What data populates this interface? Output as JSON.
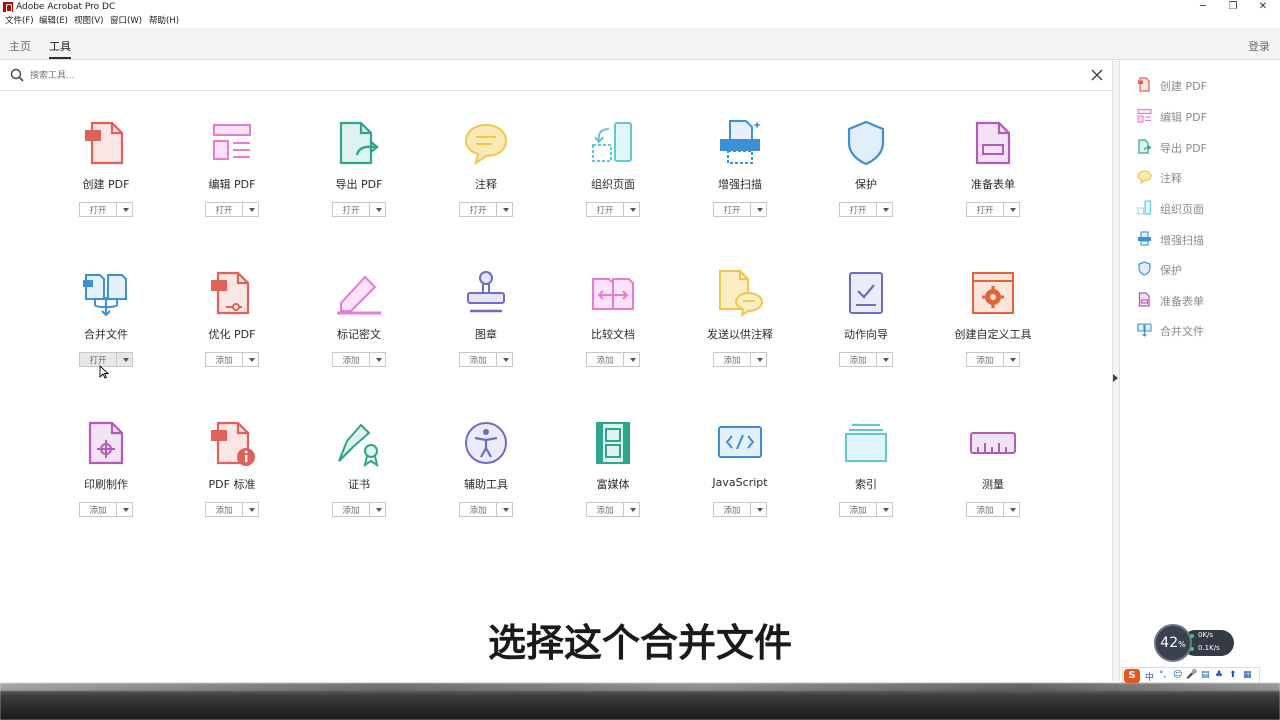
{
  "window": {
    "title": "Adobe Acrobat Pro DC",
    "minimize": "─",
    "maximize": "❐",
    "close": "✕"
  },
  "menu": [
    "文件(F)",
    "编辑(E)",
    "视图(V)",
    "窗口(W)",
    "帮助(H)"
  ],
  "nav": {
    "tabs": [
      "主页",
      "工具"
    ],
    "active_tab": "工具",
    "login": "登录"
  },
  "search": {
    "placeholder": "搜索工具..."
  },
  "tools": [
    {
      "label": "创建 PDF",
      "button": "打开",
      "icon": "create-pdf-icon"
    },
    {
      "label": "编辑 PDF",
      "button": "打开",
      "icon": "edit-pdf-icon"
    },
    {
      "label": "导出 PDF",
      "button": "打开",
      "icon": "export-pdf-icon"
    },
    {
      "label": "注释",
      "button": "打开",
      "icon": "comment-icon"
    },
    {
      "label": "组织页面",
      "button": "打开",
      "icon": "organize-pages-icon"
    },
    {
      "label": "增强扫描",
      "button": "打开",
      "icon": "enhance-scan-icon"
    },
    {
      "label": "保护",
      "button": "打开",
      "icon": "protect-icon"
    },
    {
      "label": "准备表单",
      "button": "打开",
      "icon": "prepare-form-icon"
    },
    {
      "label": "合并文件",
      "button": "打开",
      "icon": "combine-files-icon"
    },
    {
      "label": "优化 PDF",
      "button": "添加",
      "icon": "optimize-pdf-icon"
    },
    {
      "label": "标记密文",
      "button": "添加",
      "icon": "redact-icon"
    },
    {
      "label": "图章",
      "button": "添加",
      "icon": "stamp-icon"
    },
    {
      "label": "比较文档",
      "button": "添加",
      "icon": "compare-files-icon"
    },
    {
      "label": "发送以供注释",
      "button": "添加",
      "icon": "send-for-comments-icon"
    },
    {
      "label": "动作向导",
      "button": "添加",
      "icon": "action-wizard-icon"
    },
    {
      "label": "创建自定义工具",
      "button": "添加",
      "icon": "custom-tool-icon"
    },
    {
      "label": "印刷制作",
      "button": "添加",
      "icon": "print-production-icon"
    },
    {
      "label": "PDF 标准",
      "button": "添加",
      "icon": "pdf-standards-icon"
    },
    {
      "label": "证书",
      "button": "添加",
      "icon": "certificates-icon"
    },
    {
      "label": "辅助工具",
      "button": "添加",
      "icon": "accessibility-icon"
    },
    {
      "label": "富媒体",
      "button": "添加",
      "icon": "rich-media-icon"
    },
    {
      "label": "JavaScript",
      "button": "添加",
      "icon": "javascript-icon"
    },
    {
      "label": "索引",
      "button": "添加",
      "icon": "index-icon"
    },
    {
      "label": "测量",
      "button": "添加",
      "icon": "measure-icon"
    }
  ],
  "right_panel": [
    {
      "label": "创建 PDF",
      "icon": "create-pdf-icon"
    },
    {
      "label": "编辑 PDF",
      "icon": "edit-pdf-icon"
    },
    {
      "label": "导出 PDF",
      "icon": "export-pdf-icon"
    },
    {
      "label": "注释",
      "icon": "comment-icon"
    },
    {
      "label": "组织页面",
      "icon": "organize-pages-icon"
    },
    {
      "label": "增强扫描",
      "icon": "enhance-scan-icon"
    },
    {
      "label": "保护",
      "icon": "protect-icon"
    },
    {
      "label": "准备表单",
      "icon": "prepare-form-icon"
    },
    {
      "label": "合并文件",
      "icon": "combine-files-icon"
    }
  ],
  "subtitle": "选择这个合并文件",
  "speed_widget": {
    "percent": "42",
    "suffix": "%",
    "up": "0K/s",
    "down": "0.1K/s"
  },
  "ime": {
    "logo": "S",
    "mode": "中"
  },
  "colors": {
    "red": "#e0605a",
    "pink": "#e97bd0",
    "green": "#2ea58d",
    "yellow": "#f0c64a",
    "teal": "#5fc7d6",
    "blue": "#3d8fd6",
    "purple": "#8a6fd1",
    "magenta": "#b25bb8",
    "orange": "#e16438"
  }
}
